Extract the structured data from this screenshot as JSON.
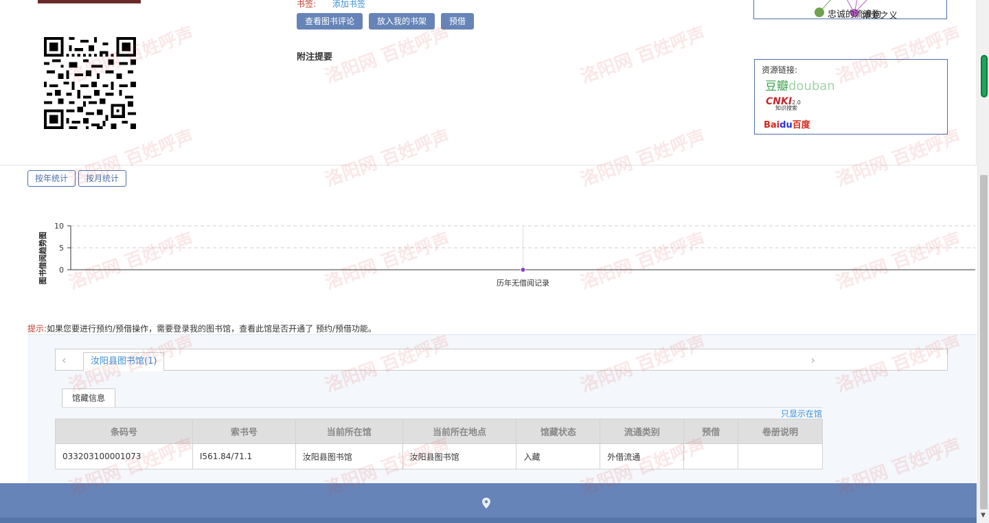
{
  "book": {
    "tag_label": "书签:",
    "tag_link": "添加书签",
    "buttons": [
      "查看图书评论",
      "放入我的书架",
      "预借"
    ],
    "note_title": "附注提要"
  },
  "graph": {
    "labels": [
      "忠诚的流浪狗",
      "博爱之义"
    ]
  },
  "resources": {
    "title": "资源链接:",
    "douban_cn": "豆瓣",
    "douban_en": "douban",
    "cnki": "CNKI",
    "cnki_ver": "2.0",
    "cnki_sub": "知识搜索",
    "baidu_a": "Bai",
    "baidu_b": "du",
    "baidu_c": "百度"
  },
  "stats": {
    "by_year": "按年统计",
    "by_month": "按月统计"
  },
  "chart_data": {
    "type": "line",
    "ylabel": "图书借阅趋势图",
    "yticks": [
      0,
      5,
      10
    ],
    "ylim": [
      0,
      10
    ],
    "categories": [
      "历年无借阅记录"
    ],
    "series": [
      {
        "values": [
          0
        ]
      }
    ],
    "colors": {
      "point": "#8a3fd1",
      "axis": "#333333",
      "grid": "#cccccc"
    }
  },
  "hint": {
    "label": "提示:",
    "text": "如果您要进行预约/预借操作，需要登录我的图书馆，查看此馆是否开通了 预约/预借功能。"
  },
  "holdings": {
    "library_tab": "汝阳县图书馆(1)",
    "sub_tab": "馆藏信息",
    "only_available": "只显示在馆",
    "columns": [
      "条码号",
      "索书号",
      "当前所在馆",
      "当前所在地点",
      "馆藏状态",
      "流通类别",
      "预借",
      "卷册说明"
    ],
    "rows": [
      [
        "033203100001073",
        "I561.84/71.1",
        "汝阳县图书馆",
        "汝阳县图书馆",
        "入藏",
        "外借流通",
        "",
        ""
      ]
    ]
  },
  "watermark": "洛阳网 百姓呼声",
  "colors": {
    "primary": "#6684b7",
    "link": "#3a8fd8",
    "red": "#c0392b"
  }
}
